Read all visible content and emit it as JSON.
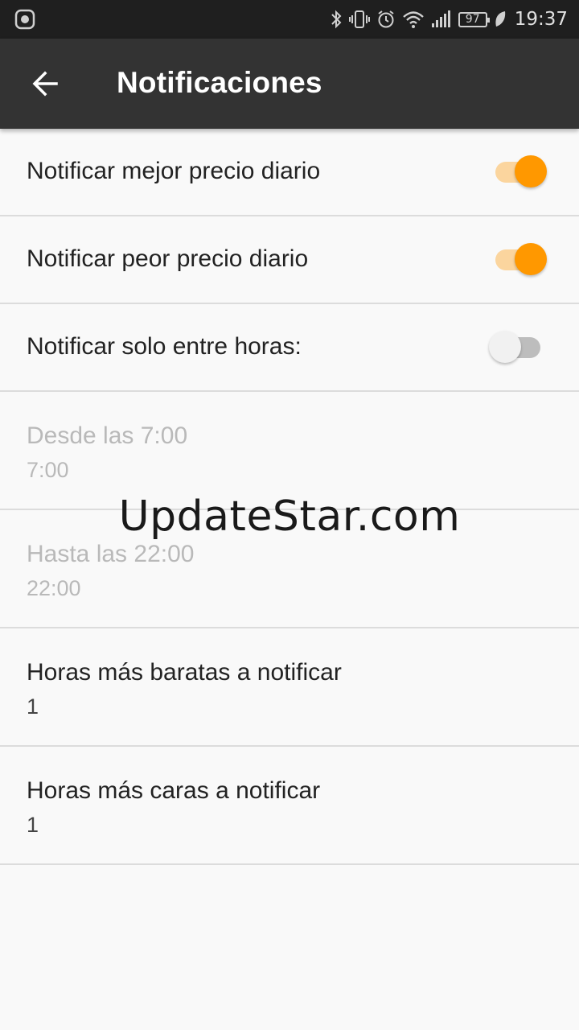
{
  "status_bar": {
    "battery": "97",
    "time": "19:37",
    "icons": [
      "gallery-icon",
      "bluetooth-icon",
      "vibrate-icon",
      "alarm-icon",
      "wifi-icon",
      "signal-icon",
      "battery-icon",
      "leaf-icon"
    ]
  },
  "app_bar": {
    "title": "Notificaciones",
    "back_icon": "arrow-left-icon"
  },
  "settings": {
    "best_price": {
      "label": "Notificar mejor precio diario",
      "enabled": true
    },
    "worst_price": {
      "label": "Notificar peor precio diario",
      "enabled": true
    },
    "only_between_hours": {
      "label": "Notificar solo entre horas:",
      "enabled": false
    },
    "from": {
      "label": "Desde las 7:00",
      "value": "7:00"
    },
    "until": {
      "label": "Hasta las 22:00",
      "value": "22:00"
    },
    "cheapest_hours": {
      "label": "Horas más baratas a notificar",
      "value": "1"
    },
    "most_expensive_hours": {
      "label": "Horas más caras a notificar",
      "value": "1"
    }
  },
  "watermark": "UpdateStar.com",
  "colors": {
    "accent": "#ff9800",
    "accent_track": "#fbd59e",
    "app_bar": "#333333",
    "status_bar": "#1f1f1f",
    "background": "#f9f9f9",
    "divider": "#dcdcdc"
  }
}
